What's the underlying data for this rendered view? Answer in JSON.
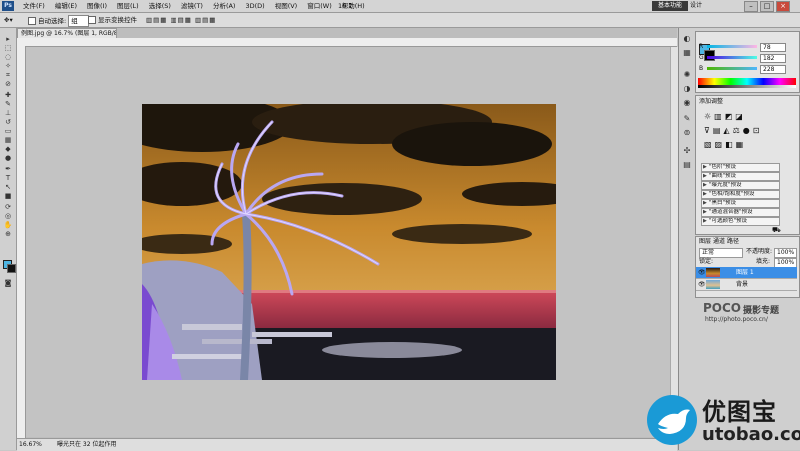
{
  "menubar": {
    "app_logo": "Ps",
    "menus": [
      "文件(F)",
      "编辑(E)",
      "图像(I)",
      "图层(L)",
      "选择(S)",
      "滤镜(T)",
      "分析(A)",
      "3D(D)",
      "视图(V)",
      "窗口(W)",
      "帮助(H)"
    ],
    "zoom": "16.7",
    "workspace_button": "基本功能",
    "workspace_label": "设计"
  },
  "options_bar": {
    "auto_select_label": "自动选择:",
    "auto_select_value": "组",
    "transform_controls_label": "显示变换控件"
  },
  "document": {
    "tab_title": "例图.jpg @ 16.7% (图层 1, RGB/8*)",
    "status_zoom": "16.67%",
    "status_text": "曝光只在 32 位起作用"
  },
  "color_panel": {
    "r_label": "R",
    "g_label": "G",
    "b_label": "B",
    "r_value": "78",
    "g_value": "182",
    "b_value": "228",
    "foreground_color": "#4eb6e4"
  },
  "adjustments_panel": {
    "title": "添加调整",
    "presets": [
      "\"色阶\"预设",
      "\"曲线\"预设",
      "\"曝光度\"预设",
      "\"色相/饱和度\"预设",
      "\"黑白\"预设",
      "\"通道混合器\"预设",
      "\"可选颜色\"预设"
    ]
  },
  "layers_panel": {
    "tabs": [
      "图层",
      "通道",
      "路径"
    ],
    "blend_mode": "正常",
    "opacity_label": "不透明度:",
    "opacity_value": "100%",
    "lock_label": "锁定:",
    "fill_label": "填充:",
    "fill_value": "100%",
    "layers": [
      {
        "name": "图层 1",
        "selected": true
      },
      {
        "name": "背景",
        "selected": false
      }
    ]
  },
  "watermarks": {
    "poco_brand": "POCO",
    "poco_tag": "摄影专题",
    "poco_url": "http://photo.poco.cn/",
    "utobao_cn": "优图宝",
    "utobao_en": "utobao.com"
  },
  "colors": {
    "accent": "#3a8fd8",
    "selected_layer": "#3b8ee6"
  }
}
